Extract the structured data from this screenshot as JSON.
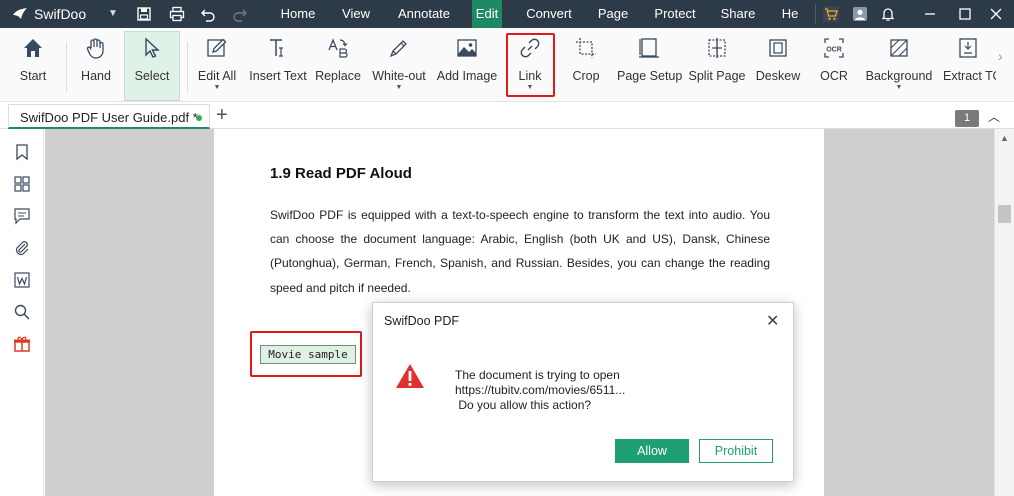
{
  "app": {
    "name": "SwifDoo",
    "icon": "bird-logo-icon",
    "quick_access": [
      "save-icon",
      "print-icon",
      "undo-icon",
      "redo-icon"
    ]
  },
  "menu": {
    "items": [
      {
        "label": "Home"
      },
      {
        "label": "View"
      },
      {
        "label": "Annotate"
      },
      {
        "label": "Edit",
        "active": true
      },
      {
        "label": "Convert"
      },
      {
        "label": "Page"
      },
      {
        "label": "Protect"
      },
      {
        "label": "Share"
      },
      {
        "label": "He"
      }
    ],
    "active_color": "#1e8a64"
  },
  "titlebar_icons": [
    "cart-icon",
    "user-icon",
    "bell-icon",
    "minimize-icon",
    "maximize-icon",
    "close-icon"
  ],
  "ribbon": {
    "tools": [
      {
        "label": "Start",
        "icon": "home-icon"
      },
      {
        "label": "Hand",
        "icon": "hand-icon"
      },
      {
        "label": "Select",
        "icon": "cursor-icon",
        "selected": true
      },
      {
        "label": "Edit All",
        "icon": "edit-icon",
        "dropdown": true
      },
      {
        "label": "Insert Text",
        "icon": "insert-text-icon"
      },
      {
        "label": "Replace",
        "icon": "replace-icon"
      },
      {
        "label": "White-out",
        "icon": "eraser-icon",
        "dropdown": true
      },
      {
        "label": "Add Image",
        "icon": "image-icon"
      },
      {
        "label": "Link",
        "icon": "link-icon",
        "dropdown": true,
        "highlighted": true
      },
      {
        "label": "Crop",
        "icon": "crop-icon"
      },
      {
        "label": "Page Setup",
        "icon": "page-setup-icon"
      },
      {
        "label": "Split Page",
        "icon": "split-page-icon"
      },
      {
        "label": "Deskew",
        "icon": "deskew-icon"
      },
      {
        "label": "OCR",
        "icon": "ocr-icon"
      },
      {
        "label": "Background",
        "icon": "background-icon",
        "dropdown": true
      },
      {
        "label": "Extract TO",
        "icon": "extract-icon"
      }
    ]
  },
  "tabs": {
    "document": "SwifDoo PDF User Guide.pdf *",
    "page_number": "1"
  },
  "sidebar_icons": [
    "bookmark-icon",
    "thumbnails-icon",
    "comments-icon",
    "attachment-icon",
    "word-icon",
    "search-icon",
    "gift-icon"
  ],
  "document": {
    "heading": "1.9 Read PDF Aloud",
    "paragraph": "SwifDoo PDF is equipped with a text-to-speech engine to transform the text into audio. You can choose the document language: Arabic, English (both UK and US), Dansk, Chinese (Putonghua), German, French, Spanish, and Russian. Besides, you can change the reading speed and pitch if needed.",
    "link_text": "Movie sample"
  },
  "dialog": {
    "title": "SwifDoo PDF",
    "message_line1": "The document is trying to open",
    "message_line2": "https://tubitv.com/movies/6511...",
    "message_line3": " Do you allow this action?",
    "allow_label": "Allow",
    "prohibit_label": "Prohibit",
    "accent": "#1e9e74",
    "warning_color": "#e03030"
  },
  "highlight_color": "#e01919"
}
